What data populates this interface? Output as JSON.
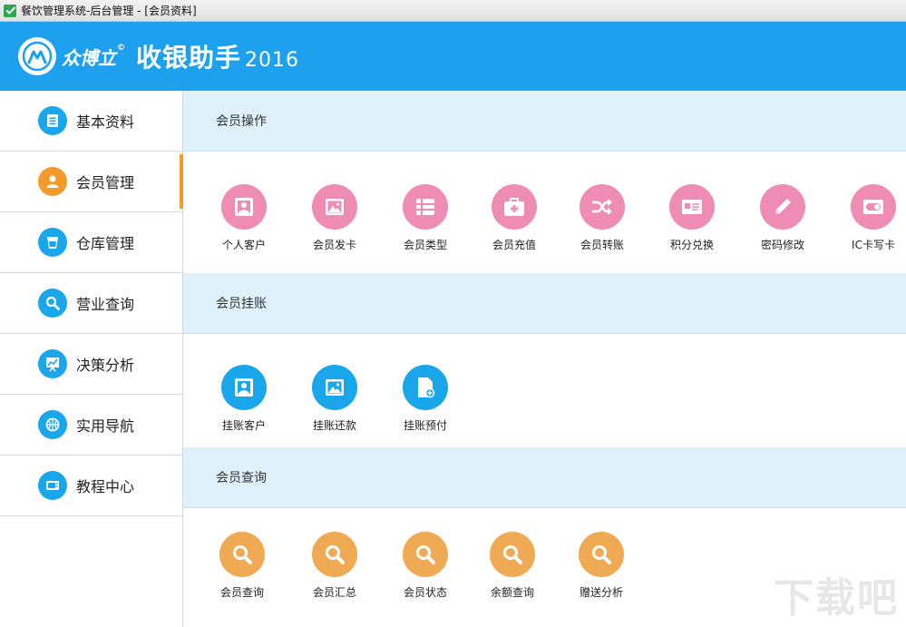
{
  "window": {
    "title": "餐饮管理系统-后台管理 - [会员资料]"
  },
  "header": {
    "brand": "众博立",
    "brand_mark": "©",
    "product": "收银助手",
    "year": "2016"
  },
  "colors": {
    "header": "#1da1ef",
    "section_bg": "#dff1fb",
    "pink": "#ee8cb3",
    "blue": "#1aa6ea",
    "orange": "#f0aa54",
    "active_marker": "#f39a2c"
  },
  "sidebar": {
    "items": [
      {
        "label": "基本资料",
        "icon": "document-icon",
        "color": "#1aa6ea"
      },
      {
        "label": "会员管理",
        "icon": "user-icon",
        "color": "#f39a2c",
        "active": true
      },
      {
        "label": "仓库管理",
        "icon": "cup-icon",
        "color": "#1aa6ea"
      },
      {
        "label": "营业查询",
        "icon": "search-icon",
        "color": "#1aa6ea"
      },
      {
        "label": "决策分析",
        "icon": "chart-icon",
        "color": "#1aa6ea"
      },
      {
        "label": "实用导航",
        "icon": "basketball-icon",
        "color": "#1aa6ea"
      },
      {
        "label": "教程中心",
        "icon": "tv-icon",
        "color": "#1aa6ea"
      }
    ]
  },
  "sections": [
    {
      "title": "会员操作",
      "items": [
        {
          "label": "个人客户",
          "icon": "portrait-icon"
        },
        {
          "label": "会员发卡",
          "icon": "picture-icon"
        },
        {
          "label": "会员类型",
          "icon": "list-icon"
        },
        {
          "label": "会员充值",
          "icon": "medkit-icon"
        },
        {
          "label": "会员转账",
          "icon": "shuffle-icon"
        },
        {
          "label": "积分兑换",
          "icon": "id-card-icon"
        },
        {
          "label": "密码修改",
          "icon": "pencil-icon"
        },
        {
          "label": "IC卡写卡",
          "icon": "toggle-card-icon"
        }
      ]
    },
    {
      "title": "会员挂账",
      "items": [
        {
          "label": "挂账客户",
          "icon": "portrait-icon"
        },
        {
          "label": "挂账还款",
          "icon": "picture-icon"
        },
        {
          "label": "挂账预付",
          "icon": "file-plus-icon"
        }
      ]
    },
    {
      "title": "会员查询",
      "items": [
        {
          "label": "会员查询",
          "icon": "search-icon"
        },
        {
          "label": "会员汇总",
          "icon": "search-icon"
        },
        {
          "label": "会员状态",
          "icon": "search-icon"
        },
        {
          "label": "余额查询",
          "icon": "search-icon"
        },
        {
          "label": "赠送分析",
          "icon": "search-icon"
        }
      ]
    }
  ],
  "watermark": "下载吧"
}
